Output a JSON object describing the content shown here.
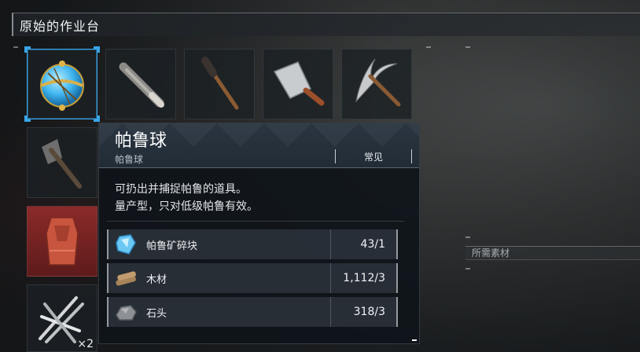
{
  "window": {
    "title": "原始的作业台"
  },
  "items": [
    {
      "name": "pal-sphere",
      "icon": "pal-sphere-icon",
      "selected": true
    },
    {
      "name": "club",
      "icon": "club-icon"
    },
    {
      "name": "torch",
      "icon": "torch-icon"
    },
    {
      "name": "cleaver",
      "icon": "cleaver-icon"
    },
    {
      "name": "pickaxe",
      "icon": "pickaxe-icon"
    },
    {
      "name": "axe",
      "icon": "axe-icon"
    },
    {
      "name": "cloth-outfit",
      "icon": "cloth-outfit-icon"
    },
    {
      "name": "nails",
      "icon": "nails-icon",
      "qty": "×2"
    }
  ],
  "detail": {
    "name": "帕鲁球",
    "subname": "帕鲁球",
    "rarity": "常见",
    "description": [
      "可扔出并捕捉帕鲁的道具。",
      "量产型，只对低级帕鲁有效。"
    ],
    "materials": [
      {
        "name": "帕鲁矿碎块",
        "count": "43/1",
        "icon": "pal-ore-icon"
      },
      {
        "name": "木材",
        "count": "1,112/3",
        "icon": "wood-icon"
      },
      {
        "name": "石头",
        "count": "318/3",
        "icon": "stone-icon"
      }
    ]
  },
  "side": {
    "required_label": "所需素材"
  },
  "colors": {
    "accent": "#39a5e8",
    "panel": "#0e141a"
  }
}
